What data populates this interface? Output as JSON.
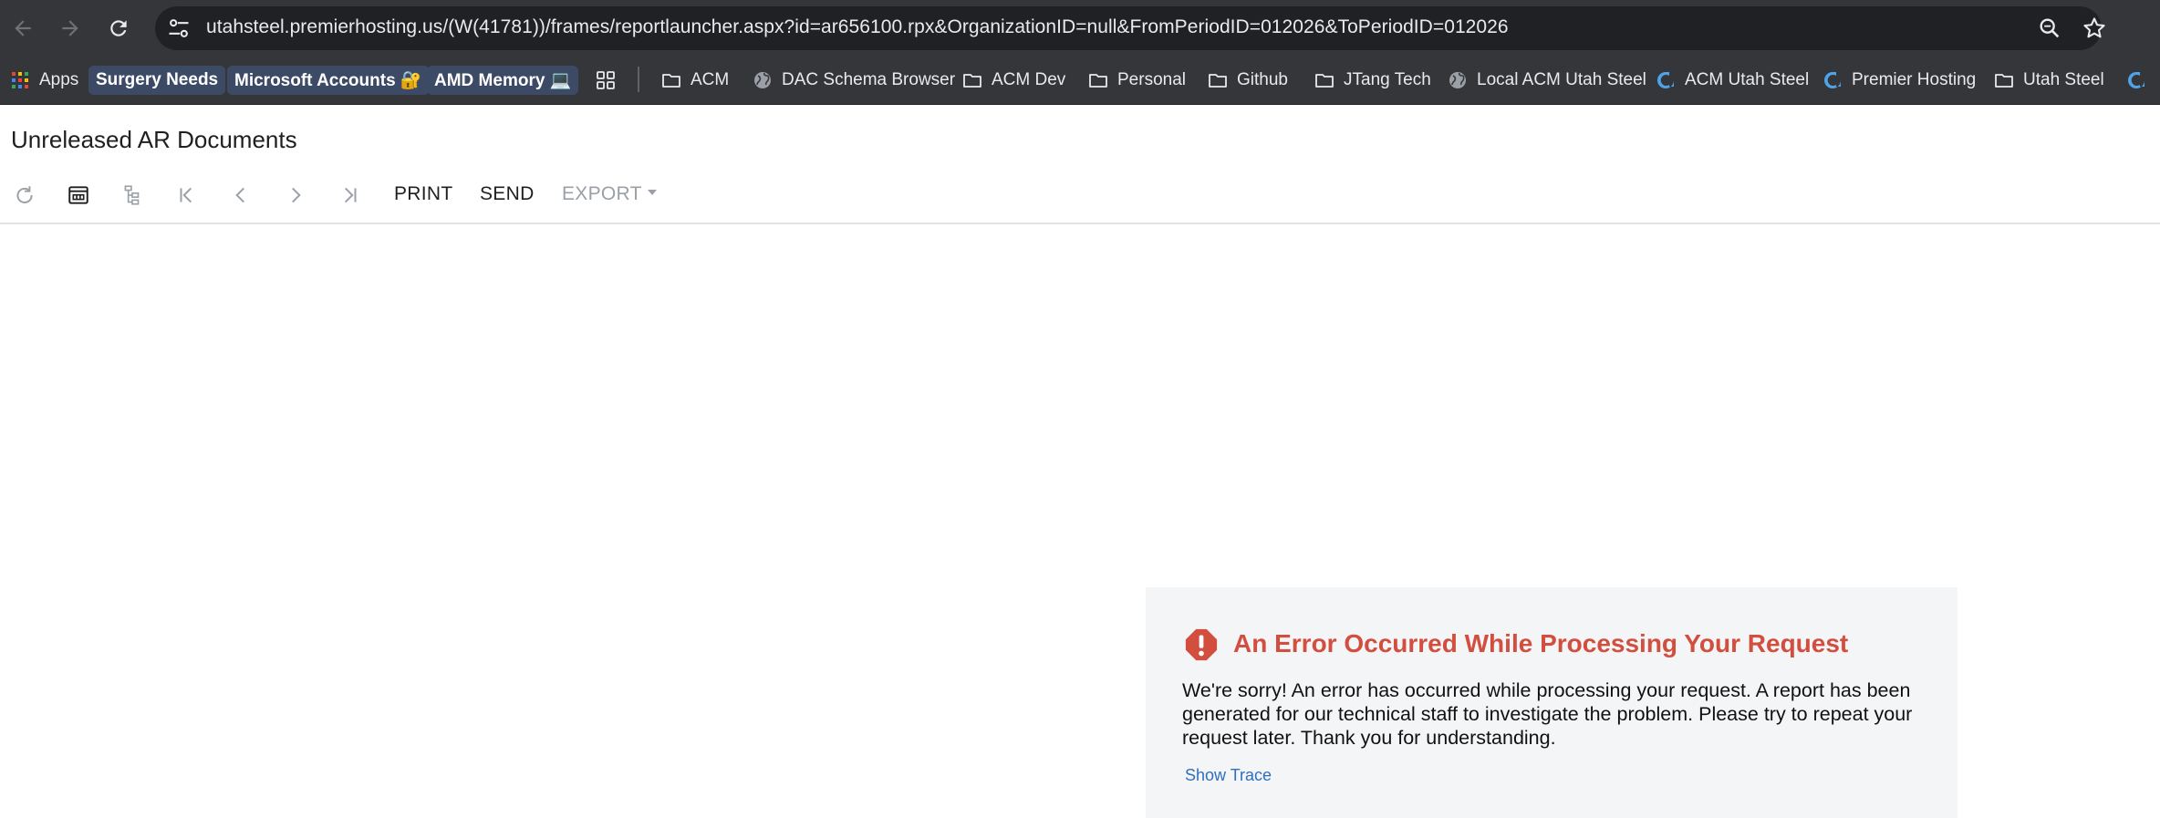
{
  "browser": {
    "url": "utahsteel.premierhosting.us/(W(41781))/frames/reportlauncher.aspx?id=ar656100.rpx&OrganizationID=null&FromPeriodID=012026&ToPeriodID=012026",
    "nav_icons": [
      "back-arrow-icon",
      "forward-arrow-icon",
      "reload-icon"
    ],
    "omnibox_icons": [
      "site-settings-icon",
      "zoom-icon",
      "star-icon"
    ]
  },
  "bookmarks": [
    {
      "label": "Apps",
      "icon": "apps-grid-icon"
    },
    {
      "label": "Surgery Needs"
    },
    {
      "label": "Microsoft Accounts 🔐"
    },
    {
      "label": "AMD Memory 💻"
    },
    {
      "label": "",
      "icon": "tab-groups-icon"
    },
    {
      "label": "ACM",
      "icon": "folder-icon"
    },
    {
      "label": "DAC Schema Browser",
      "icon": "globe-icon"
    },
    {
      "label": "ACM Dev",
      "icon": "folder-icon"
    },
    {
      "label": "Personal",
      "icon": "folder-icon"
    },
    {
      "label": "Github",
      "icon": "folder-icon"
    },
    {
      "label": "JTang Tech",
      "icon": "folder-icon"
    },
    {
      "label": "Local ACM Utah Steel",
      "icon": "globe-icon"
    },
    {
      "label": "ACM Utah Steel",
      "icon": "acumatica-icon"
    },
    {
      "label": "Premier Hosting",
      "icon": "acumatica-icon"
    },
    {
      "label": "Utah Steel",
      "icon": "folder-icon"
    }
  ],
  "page": {
    "title": "Unreleased AR Documents"
  },
  "toolbar": {
    "icons": [
      "refresh-icon",
      "parameters-icon",
      "group-tree-icon",
      "first-page-icon",
      "previous-page-icon",
      "next-page-icon",
      "last-page-icon"
    ],
    "print_label": "PRINT",
    "send_label": "SEND",
    "export_label": "EXPORT"
  },
  "error": {
    "title": "An Error Occurred While Processing Your Request",
    "message": "We're sorry! An error has occurred while processing your request. A report has been generated for our technical staff to investigate the problem. Please try to repeat your request later. Thank you for understanding.",
    "link": "Show Trace"
  },
  "colors": {
    "chrome_bg": "#35363a",
    "omnibox_bg": "#202124",
    "error_title": "#d24e3f",
    "error_bg": "#f4f5f6",
    "link": "#2f6fbe"
  }
}
